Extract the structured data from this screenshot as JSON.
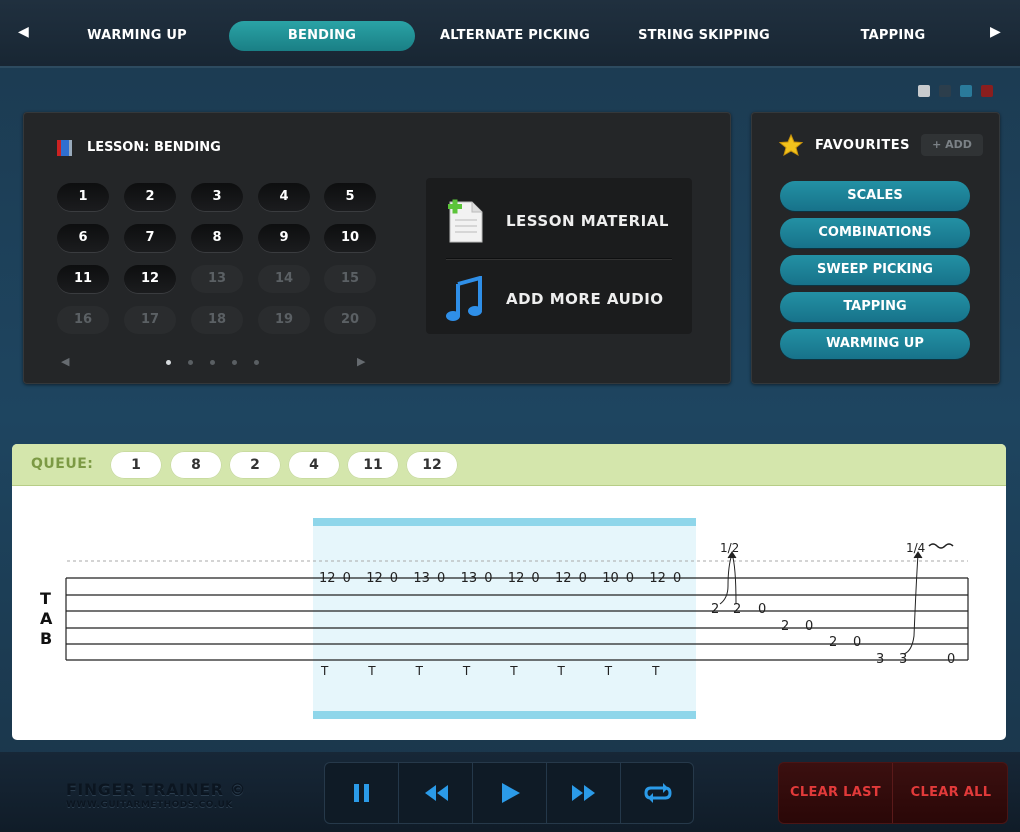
{
  "nav": {
    "prev_icon": "left-arrow-icon",
    "next_icon": "right-arrow-icon",
    "tabs": [
      {
        "label": "WARMING UP"
      },
      {
        "label": "BENDING"
      },
      {
        "label": "ALTERNATE PICKING"
      },
      {
        "label": "STRING SKIPPING"
      },
      {
        "label": "TAPPING"
      }
    ],
    "active_tab": "BENDING",
    "accent_color": "#2aa3a6"
  },
  "theme_colors": [
    "#c8cbce",
    "#2c3e4c",
    "#2a7a9a",
    "#8a1e1e"
  ],
  "lesson": {
    "prefix": "LESSON:",
    "name": "BENDING",
    "numbers": [
      "1",
      "2",
      "3",
      "4",
      "5",
      "6",
      "7",
      "8",
      "9",
      "10",
      "11",
      "12",
      "13",
      "14",
      "15",
      "16",
      "17",
      "18",
      "19",
      "20"
    ],
    "available_count": 12,
    "page_count": 5,
    "current_page": 1
  },
  "material": {
    "lesson_material": "LESSON MATERIAL",
    "add_audio": "ADD MORE AUDIO"
  },
  "favourites": {
    "title": "FAVOURITES",
    "add_label": "+ ADD",
    "items": [
      "SCALES",
      "COMBINATIONS",
      "SWEEP PICKING",
      "TAPPING",
      "WARMING UP"
    ]
  },
  "queue": {
    "label": "QUEUE:",
    "items": [
      "1",
      "8",
      "2",
      "4",
      "11",
      "12"
    ]
  },
  "tab": {
    "clef": [
      "T",
      "A",
      "B"
    ],
    "top_string_notes": [
      "12",
      "0",
      "12",
      "0",
      "13",
      "0",
      "13",
      "0",
      "12",
      "0",
      "12",
      "0",
      "10",
      "0",
      "12",
      "0"
    ],
    "tap_marks": [
      "T",
      "T",
      "T",
      "T",
      "T",
      "T",
      "T",
      "T"
    ],
    "bend_labels": [
      "1/2",
      "1/4"
    ],
    "string2_notes": [
      "2",
      "2",
      "0"
    ],
    "string3_notes": [
      "2",
      "0"
    ],
    "string4_notes": [
      "2",
      "0"
    ],
    "string5_notes": [
      "3",
      "3",
      "0"
    ]
  },
  "footer": {
    "brand": "FINGER TRAINER ©",
    "site": "WWW.GUITARMETHODS.CO.UK",
    "transport_icons": [
      "pause-icon",
      "rewind-icon",
      "play-icon",
      "fast-forward-icon",
      "loop-icon"
    ],
    "clear_last": "CLEAR LAST",
    "clear_all": "CLEAR ALL"
  }
}
